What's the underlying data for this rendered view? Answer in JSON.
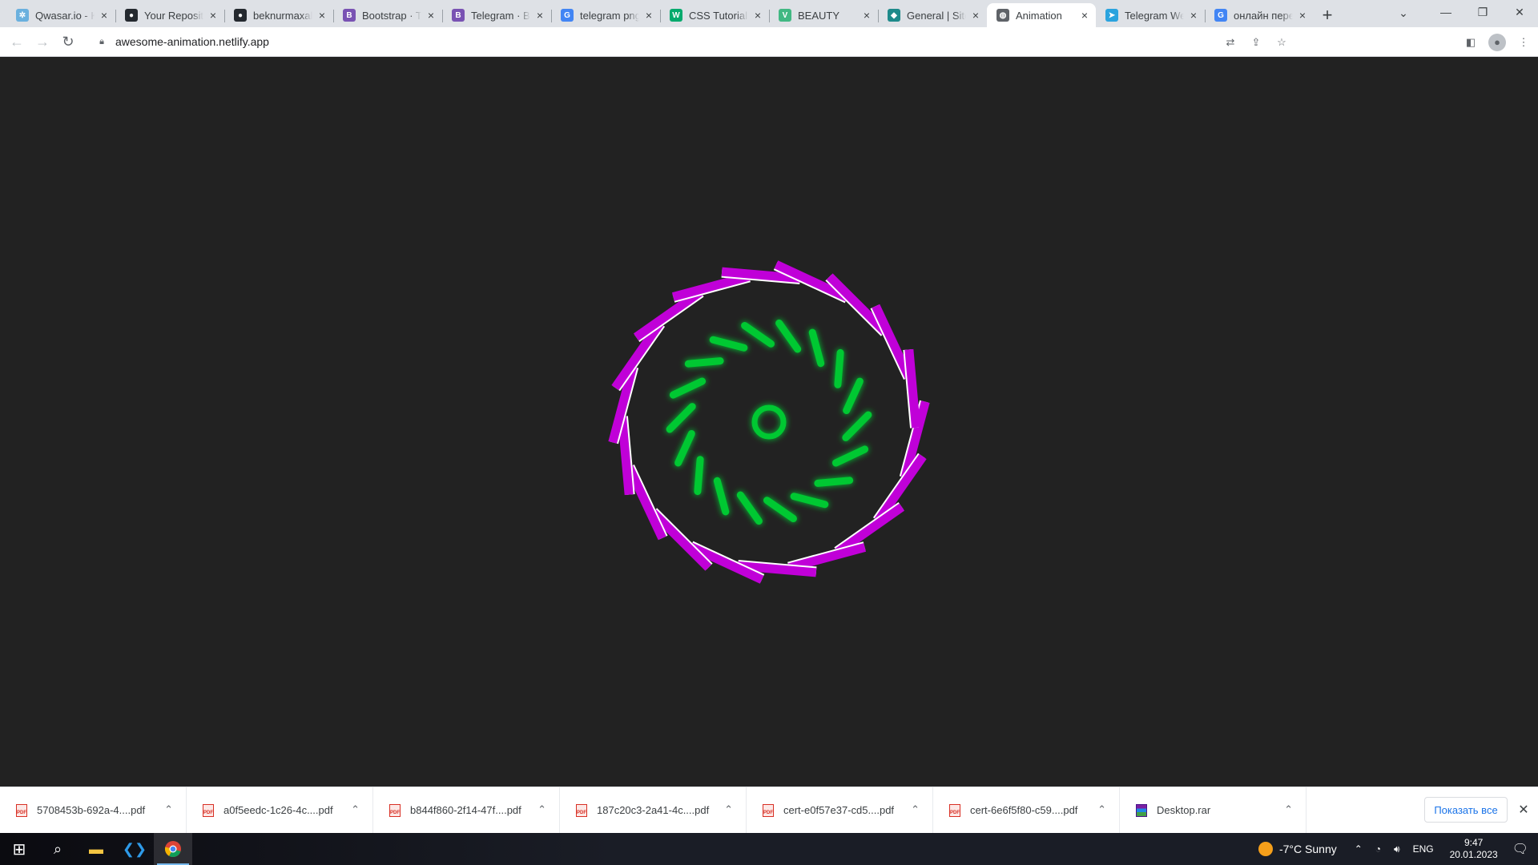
{
  "browser": {
    "tabs": [
      {
        "title": "Qwasar.io - K",
        "favicon": "qwasar-icon",
        "color": "#6ab0de",
        "glyph": "✲",
        "active": false
      },
      {
        "title": "Your Repositor",
        "favicon": "github-icon",
        "color": "#24292f",
        "glyph": "●",
        "active": false
      },
      {
        "title": "beknurmaxall",
        "favicon": "github-icon",
        "color": "#24292f",
        "glyph": "●",
        "active": false
      },
      {
        "title": "Bootstrap · Th",
        "favicon": "bootstrap-icon",
        "color": "#7952b3",
        "glyph": "B",
        "active": false
      },
      {
        "title": "Telegram · Bo",
        "favicon": "bootstrap-icon",
        "color": "#7952b3",
        "glyph": "B",
        "active": false
      },
      {
        "title": "telegram png",
        "favicon": "google-icon",
        "color": "#4285f4",
        "glyph": "G",
        "active": false
      },
      {
        "title": "CSS Tutorial",
        "favicon": "w3schools-icon",
        "color": "#04aa6d",
        "glyph": "W",
        "active": false
      },
      {
        "title": "BEAUTY",
        "favicon": "vue-icon",
        "color": "#41b883",
        "glyph": "V",
        "active": false
      },
      {
        "title": "General | Site",
        "favicon": "diamond-icon",
        "color": "#1e8a8a",
        "glyph": "◆",
        "active": false
      },
      {
        "title": "Animation",
        "favicon": "globe-icon",
        "color": "#5f6368",
        "glyph": "◍",
        "active": true
      },
      {
        "title": "Telegram We",
        "favicon": "telegram-icon",
        "color": "#2aa3de",
        "glyph": "➤",
        "active": false
      },
      {
        "title": "онлайн пере",
        "favicon": "google-icon",
        "color": "#4285f4",
        "glyph": "G",
        "active": false
      }
    ],
    "new_tab": "+",
    "url": "awesome-animation.netlify.app"
  },
  "page": {
    "background": "#222222",
    "outer_color": "#c000d8",
    "inner_color": "#00c832",
    "outer_count": 18,
    "inner_count": 18
  },
  "downloads": {
    "items": [
      {
        "name": "5708453b-692a-4....pdf",
        "type": "pdf"
      },
      {
        "name": "a0f5eedc-1c26-4c....pdf",
        "type": "pdf"
      },
      {
        "name": "b844f860-2f14-47f....pdf",
        "type": "pdf"
      },
      {
        "name": "187c20c3-2a41-4c....pdf",
        "type": "pdf"
      },
      {
        "name": "cert-e0f57e37-cd5....pdf",
        "type": "pdf"
      },
      {
        "name": "cert-6e6f5f80-c59....pdf",
        "type": "pdf"
      },
      {
        "name": "Desktop.rar",
        "type": "rar"
      }
    ],
    "show_all": "Показать все"
  },
  "taskbar": {
    "weather": "-7°C  Sunny",
    "language": "ENG",
    "time": "9:47",
    "date": "20.01.2023"
  }
}
